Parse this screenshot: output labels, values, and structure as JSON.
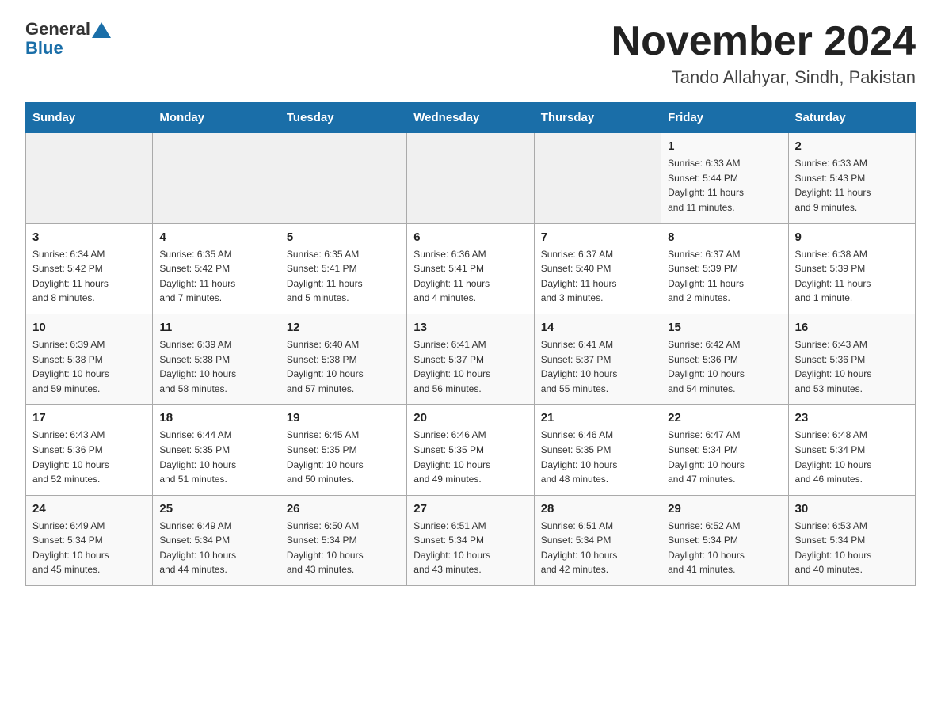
{
  "header": {
    "logo_general": "General",
    "logo_blue": "Blue",
    "month_title": "November 2024",
    "location": "Tando Allahyar, Sindh, Pakistan"
  },
  "weekdays": [
    "Sunday",
    "Monday",
    "Tuesday",
    "Wednesday",
    "Thursday",
    "Friday",
    "Saturday"
  ],
  "weeks": [
    [
      {
        "day": "",
        "info": ""
      },
      {
        "day": "",
        "info": ""
      },
      {
        "day": "",
        "info": ""
      },
      {
        "day": "",
        "info": ""
      },
      {
        "day": "",
        "info": ""
      },
      {
        "day": "1",
        "info": "Sunrise: 6:33 AM\nSunset: 5:44 PM\nDaylight: 11 hours\nand 11 minutes."
      },
      {
        "day": "2",
        "info": "Sunrise: 6:33 AM\nSunset: 5:43 PM\nDaylight: 11 hours\nand 9 minutes."
      }
    ],
    [
      {
        "day": "3",
        "info": "Sunrise: 6:34 AM\nSunset: 5:42 PM\nDaylight: 11 hours\nand 8 minutes."
      },
      {
        "day": "4",
        "info": "Sunrise: 6:35 AM\nSunset: 5:42 PM\nDaylight: 11 hours\nand 7 minutes."
      },
      {
        "day": "5",
        "info": "Sunrise: 6:35 AM\nSunset: 5:41 PM\nDaylight: 11 hours\nand 5 minutes."
      },
      {
        "day": "6",
        "info": "Sunrise: 6:36 AM\nSunset: 5:41 PM\nDaylight: 11 hours\nand 4 minutes."
      },
      {
        "day": "7",
        "info": "Sunrise: 6:37 AM\nSunset: 5:40 PM\nDaylight: 11 hours\nand 3 minutes."
      },
      {
        "day": "8",
        "info": "Sunrise: 6:37 AM\nSunset: 5:39 PM\nDaylight: 11 hours\nand 2 minutes."
      },
      {
        "day": "9",
        "info": "Sunrise: 6:38 AM\nSunset: 5:39 PM\nDaylight: 11 hours\nand 1 minute."
      }
    ],
    [
      {
        "day": "10",
        "info": "Sunrise: 6:39 AM\nSunset: 5:38 PM\nDaylight: 10 hours\nand 59 minutes."
      },
      {
        "day": "11",
        "info": "Sunrise: 6:39 AM\nSunset: 5:38 PM\nDaylight: 10 hours\nand 58 minutes."
      },
      {
        "day": "12",
        "info": "Sunrise: 6:40 AM\nSunset: 5:38 PM\nDaylight: 10 hours\nand 57 minutes."
      },
      {
        "day": "13",
        "info": "Sunrise: 6:41 AM\nSunset: 5:37 PM\nDaylight: 10 hours\nand 56 minutes."
      },
      {
        "day": "14",
        "info": "Sunrise: 6:41 AM\nSunset: 5:37 PM\nDaylight: 10 hours\nand 55 minutes."
      },
      {
        "day": "15",
        "info": "Sunrise: 6:42 AM\nSunset: 5:36 PM\nDaylight: 10 hours\nand 54 minutes."
      },
      {
        "day": "16",
        "info": "Sunrise: 6:43 AM\nSunset: 5:36 PM\nDaylight: 10 hours\nand 53 minutes."
      }
    ],
    [
      {
        "day": "17",
        "info": "Sunrise: 6:43 AM\nSunset: 5:36 PM\nDaylight: 10 hours\nand 52 minutes."
      },
      {
        "day": "18",
        "info": "Sunrise: 6:44 AM\nSunset: 5:35 PM\nDaylight: 10 hours\nand 51 minutes."
      },
      {
        "day": "19",
        "info": "Sunrise: 6:45 AM\nSunset: 5:35 PM\nDaylight: 10 hours\nand 50 minutes."
      },
      {
        "day": "20",
        "info": "Sunrise: 6:46 AM\nSunset: 5:35 PM\nDaylight: 10 hours\nand 49 minutes."
      },
      {
        "day": "21",
        "info": "Sunrise: 6:46 AM\nSunset: 5:35 PM\nDaylight: 10 hours\nand 48 minutes."
      },
      {
        "day": "22",
        "info": "Sunrise: 6:47 AM\nSunset: 5:34 PM\nDaylight: 10 hours\nand 47 minutes."
      },
      {
        "day": "23",
        "info": "Sunrise: 6:48 AM\nSunset: 5:34 PM\nDaylight: 10 hours\nand 46 minutes."
      }
    ],
    [
      {
        "day": "24",
        "info": "Sunrise: 6:49 AM\nSunset: 5:34 PM\nDaylight: 10 hours\nand 45 minutes."
      },
      {
        "day": "25",
        "info": "Sunrise: 6:49 AM\nSunset: 5:34 PM\nDaylight: 10 hours\nand 44 minutes."
      },
      {
        "day": "26",
        "info": "Sunrise: 6:50 AM\nSunset: 5:34 PM\nDaylight: 10 hours\nand 43 minutes."
      },
      {
        "day": "27",
        "info": "Sunrise: 6:51 AM\nSunset: 5:34 PM\nDaylight: 10 hours\nand 43 minutes."
      },
      {
        "day": "28",
        "info": "Sunrise: 6:51 AM\nSunset: 5:34 PM\nDaylight: 10 hours\nand 42 minutes."
      },
      {
        "day": "29",
        "info": "Sunrise: 6:52 AM\nSunset: 5:34 PM\nDaylight: 10 hours\nand 41 minutes."
      },
      {
        "day": "30",
        "info": "Sunrise: 6:53 AM\nSunset: 5:34 PM\nDaylight: 10 hours\nand 40 minutes."
      }
    ]
  ]
}
